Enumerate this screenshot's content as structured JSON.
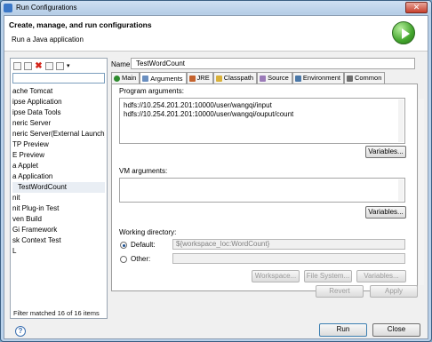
{
  "window": {
    "title": "Run Configurations",
    "close_glyph": "✕"
  },
  "header": {
    "title": "Create, manage, and run configurations",
    "subtitle": "Run a Java application"
  },
  "left": {
    "configs": [
      "ache Tomcat",
      "ipse Application",
      "ipse Data Tools",
      "neric Server",
      "neric Server(External Launch)",
      "TP Preview",
      "E Preview",
      "a Applet",
      "a Application",
      "TestWordCount",
      "nit",
      "nit Plug-in Test",
      "ven Build",
      "Gi Framework",
      "sk Context Test",
      "L"
    ],
    "filter_message": "Filter matched 16 of 16 items"
  },
  "right": {
    "name_label": "Name:",
    "name_value": "TestWordCount",
    "tabs": [
      {
        "label": "Main",
        "icon": "main-tab-icon"
      },
      {
        "label": "Arguments",
        "icon": "arguments-tab-icon"
      },
      {
        "label": "JRE",
        "icon": "jre-tab-icon"
      },
      {
        "label": "Classpath",
        "icon": "classpath-tab-icon"
      },
      {
        "label": "Source",
        "icon": "source-tab-icon"
      },
      {
        "label": "Environment",
        "icon": "environment-tab-icon"
      },
      {
        "label": "Common",
        "icon": "common-tab-icon"
      }
    ],
    "program_args_label": "Program arguments:",
    "program_args_lines": [
      "hdfs://10.254.201.201:10000/user/wangqi/input",
      "hdfs://10.254.201.201:10000/user/wangqi/ouput/count"
    ],
    "vm_args_label": "VM arguments:",
    "variables_button": "Variables...",
    "working_dir_label": "Working directory:",
    "default_label": "Default:",
    "default_value": "${workspace_loc:WordCount}",
    "other_label": "Other:",
    "workspace_button": "Workspace...",
    "filesystem_button": "File System...",
    "revert_button": "Revert",
    "apply_button": "Apply"
  },
  "footer": {
    "help_glyph": "?",
    "run_button": "Run",
    "close_button": "Close"
  },
  "colors": {
    "selection": "#e9eef4",
    "titlebar": "#b9d1ea"
  }
}
